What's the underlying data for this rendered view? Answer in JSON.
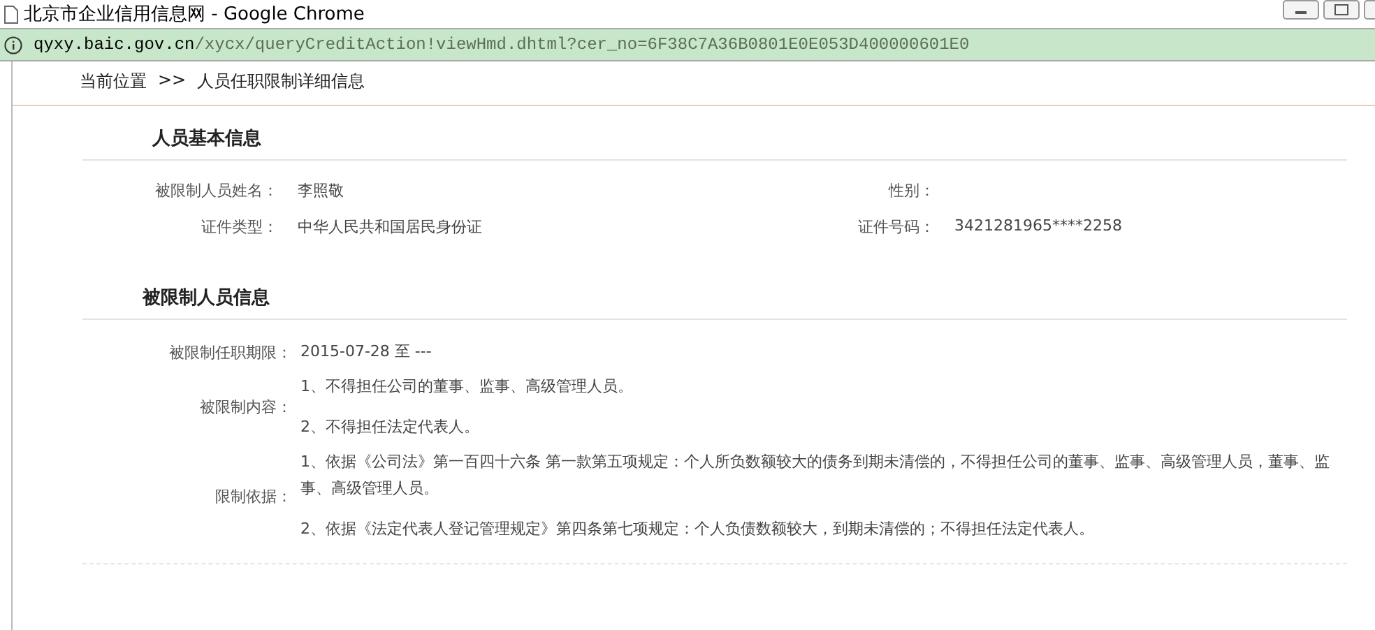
{
  "window": {
    "title": "北京市企业信用信息网 - Google Chrome"
  },
  "address_bar": {
    "host": "qyxy.baic.gov.cn",
    "path": "/xycx/queryCreditAction!viewHmd.dhtml?cer_no=6F38C7A36B0801E0E053D400000601E0"
  },
  "breadcrumb": {
    "label": "当前位置",
    "separator": ">>",
    "current": "人员任职限制详细信息"
  },
  "basic_info": {
    "title": "人员基本信息",
    "fields": [
      {
        "label": "被限制人员姓名：",
        "value": "李照敬"
      },
      {
        "label": "性别："
      },
      {
        "label": "证件类型：",
        "value": "中华人民共和国居民身份证"
      },
      {
        "label": "证件号码：",
        "value": "3421281965****2258"
      }
    ]
  },
  "restriction_info": {
    "title": "被限制人员信息",
    "rows": [
      {
        "label": "被限制任职期限：",
        "lines": [
          "2015-07-28 至 ---"
        ]
      },
      {
        "label": "被限制内容：",
        "lines": [
          "1、不得担任公司的董事、监事、高级管理人员。",
          "2、不得担任法定代表人。"
        ]
      },
      {
        "label": "限制依据：",
        "lines": [
          "1、依据《公司法》第一百四十六条 第一款第五项规定：个人所负数额较大的债务到期未清偿的，不得担任公司的董事、监事、高级管理人员，董事、监事、高级管理人员。",
          "2、依据《法定代表人登记管理规定》第四条第七项规定：个人负债数额较大，到期未清偿的；不得担任法定代表人。"
        ]
      }
    ]
  }
}
